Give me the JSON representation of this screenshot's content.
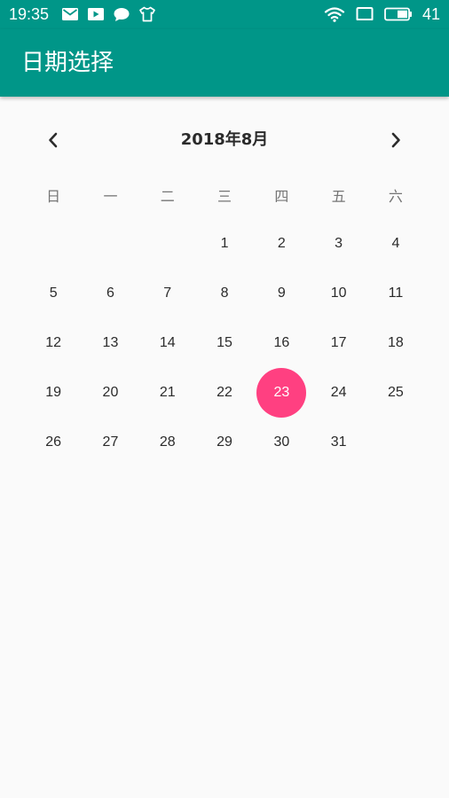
{
  "colors": {
    "primary": "#009688",
    "accent": "#ff4081",
    "background": "#fafafa",
    "text": "#2b2b2b",
    "weekday_text": "#757575"
  },
  "status_bar": {
    "time": "19:35",
    "battery": "41",
    "left_icons": [
      "mail-icon",
      "play-icon",
      "chat-icon",
      "shirt-icon"
    ],
    "right_icons": [
      "wifi-icon",
      "screen-rotate-icon",
      "battery-icon"
    ]
  },
  "app_bar": {
    "title": "日期选择"
  },
  "calendar": {
    "month_label": "2018年8月",
    "prev_icon": "chevron-left-icon",
    "next_icon": "chevron-right-icon",
    "weekdays": [
      "日",
      "一",
      "二",
      "三",
      "四",
      "五",
      "六"
    ],
    "leading_blanks": 3,
    "days": [
      "1",
      "2",
      "3",
      "4",
      "5",
      "6",
      "7",
      "8",
      "9",
      "10",
      "11",
      "12",
      "13",
      "14",
      "15",
      "16",
      "17",
      "18",
      "19",
      "20",
      "21",
      "22",
      "23",
      "24",
      "25",
      "26",
      "27",
      "28",
      "29",
      "30",
      "31"
    ],
    "selected_day": "23"
  }
}
